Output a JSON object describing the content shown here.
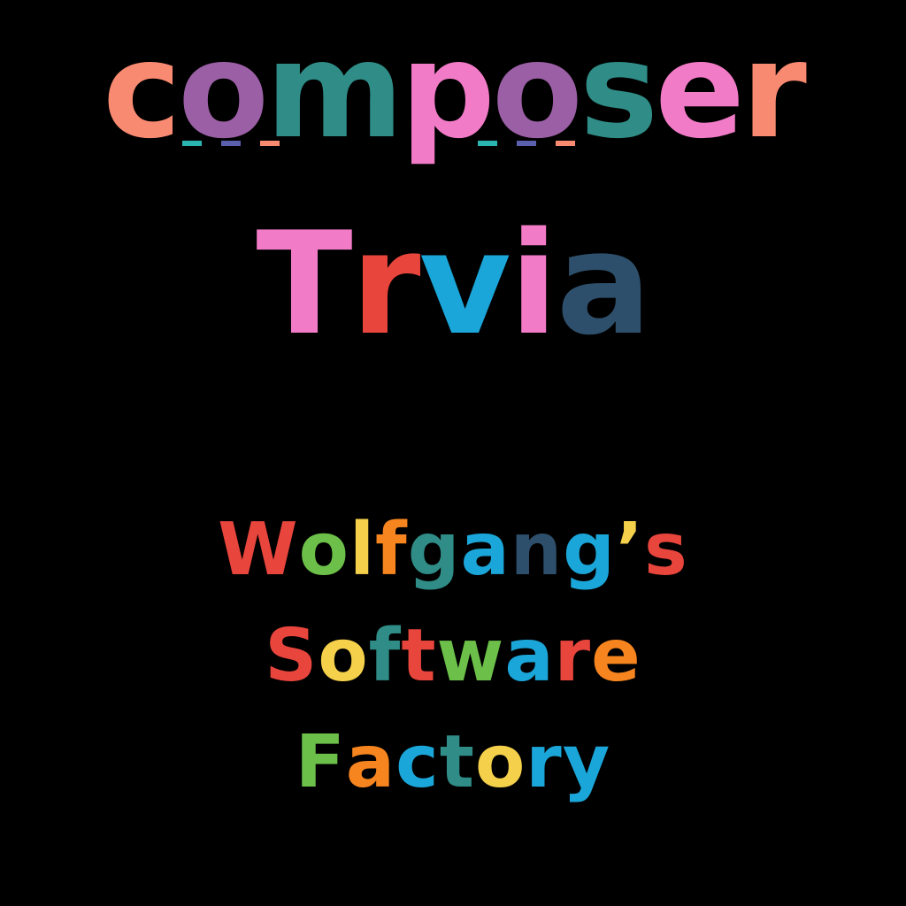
{
  "title": {
    "line1": "composer",
    "line2": "Trvia"
  },
  "studio": {
    "line1": "Wolfgang’s",
    "line2": "Software",
    "line3": "Factory"
  },
  "colors": {
    "background": "#000000",
    "coral": "#F98A72",
    "purple": "#9B5FA5",
    "green": "#6CC04A",
    "teal": "#2F8C86",
    "pink": "#F27BC8",
    "yellow": "#F5D04B",
    "navy": "#2E4F6B",
    "red": "#E8453C",
    "blue": "#1BA6D9",
    "orange": "#F7851F"
  }
}
